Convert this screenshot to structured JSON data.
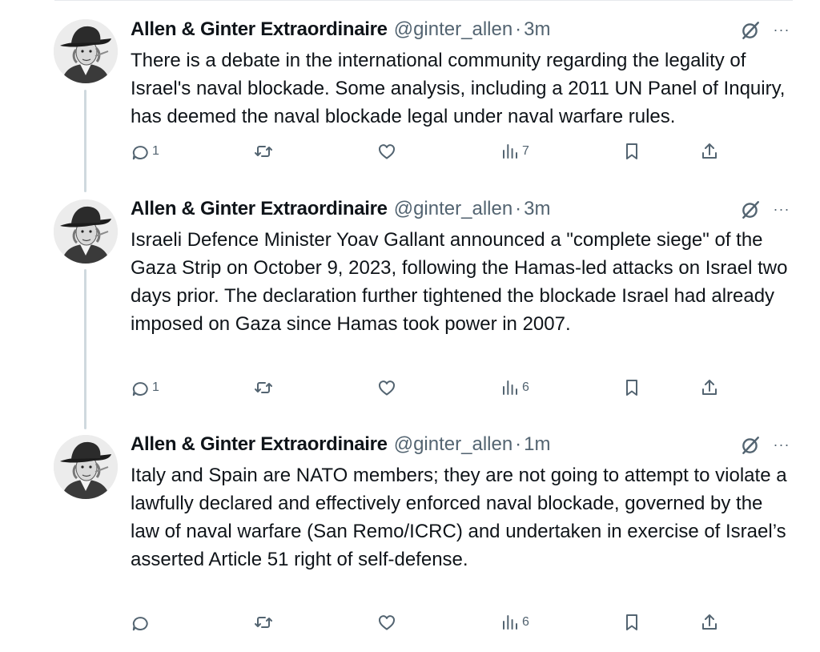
{
  "tweets": [
    {
      "author": "Allen & Ginter Extraordinaire",
      "handle": "@ginter_allen",
      "dot": "·",
      "time": "3m",
      "text": "There is a debate in the international community regarding the legality of Israel's naval blockade. Some analysis, including a 2011 UN Panel of Inquiry, has deemed the naval blockade legal under naval warfare rules.",
      "replies": "1",
      "reposts": "",
      "likes": "",
      "views": "7"
    },
    {
      "author": "Allen & Ginter Extraordinaire",
      "handle": "@ginter_allen",
      "dot": "·",
      "time": "3m",
      "text": "Israeli Defence Minister Yoav Gallant announced a \"complete siege\" of the Gaza Strip on October 9, 2023, following the Hamas-led attacks on Israel two days prior. The declaration further tightened the blockade Israel had already imposed on Gaza since Hamas took power in 2007.",
      "replies": "1",
      "reposts": "",
      "likes": "",
      "views": "6"
    },
    {
      "author": "Allen & Ginter Extraordinaire",
      "handle": "@ginter_allen",
      "dot": "·",
      "time": "1m",
      "text": "Italy and Spain are NATO members; they are not going to attempt to violate a lawfully declared and effectively enforced naval blockade, governed by the law of naval warfare (San Remo/ICRC) and undertaken in exercise of Israel’s asserted Article 51 right of self-defense.",
      "replies": "",
      "reposts": "",
      "likes": "",
      "views": "6"
    }
  ],
  "icons": {
    "grok": "grok-icon",
    "more": "more-icon",
    "reply": "reply-icon",
    "repost": "repost-icon",
    "like": "like-icon",
    "views": "views-icon",
    "bookmark": "bookmark-icon",
    "share": "share-icon"
  },
  "more_glyph": "···",
  "colors": {
    "text": "#0f1419",
    "secondary": "#536471",
    "thread_line": "#cfd9de"
  }
}
